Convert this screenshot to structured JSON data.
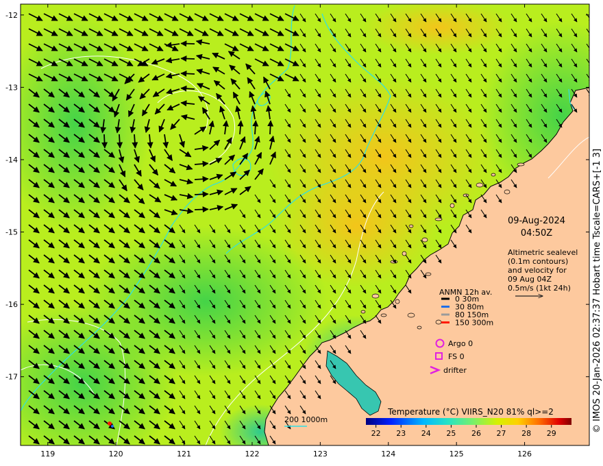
{
  "plot": {
    "lon_range": [
      118.6,
      126.95
    ],
    "lat_range": [
      -17.95,
      -11.85
    ],
    "lon_ticks": [
      "119",
      "120",
      "121",
      "122",
      "123",
      "124",
      "125",
      "126"
    ],
    "lat_ticks": [
      "-12",
      "-13",
      "-14",
      "-15",
      "-16",
      "-17"
    ],
    "lon_tick_values": [
      119,
      120,
      121,
      122,
      123,
      124,
      125,
      126
    ],
    "lat_tick_values": [
      -12,
      -13,
      -14,
      -15,
      -16,
      -17
    ]
  },
  "annotation": {
    "date": "09-Aug-2024",
    "time": "04:50Z",
    "desc_lines": [
      "Altimetric sealevel",
      "(0.1m contours)",
      "and velocity for",
      "09 Aug 04Z",
      "0.5m/s (1kt 24h)"
    ]
  },
  "legend": {
    "title": "ANMN 12h av.",
    "items": [
      {
        "label": "0 30m",
        "color": "#000000"
      },
      {
        "label": "30 80m",
        "color": "#1e6ee8"
      },
      {
        "label": "80 150m",
        "color": "#9a9a9a"
      },
      {
        "label": "150 300m",
        "color": "#ff1a00"
      }
    ],
    "argo": "Argo 0",
    "fs": "FS 0",
    "drifter": "drifter",
    "marker_color": "#e020e0"
  },
  "isobath_label": "200  1000m",
  "colorbar": {
    "title": "Temperature (°C) VIIRS_N20 81% ql>=2",
    "ticks": [
      "22",
      "23",
      "24",
      "25",
      "26",
      "27",
      "28",
      "29"
    ],
    "range": [
      21.6,
      29.8
    ]
  },
  "side_caption": "© IMOS 20-Jan-2026 02:37:37 Hobart time Tscale=CARS+[-1 3]",
  "colors": {
    "land": "#fdc99e",
    "sea_base": "#b9ee1e",
    "isobath": "#2ee0e6",
    "sealevel_contour": "#ffffff"
  }
}
